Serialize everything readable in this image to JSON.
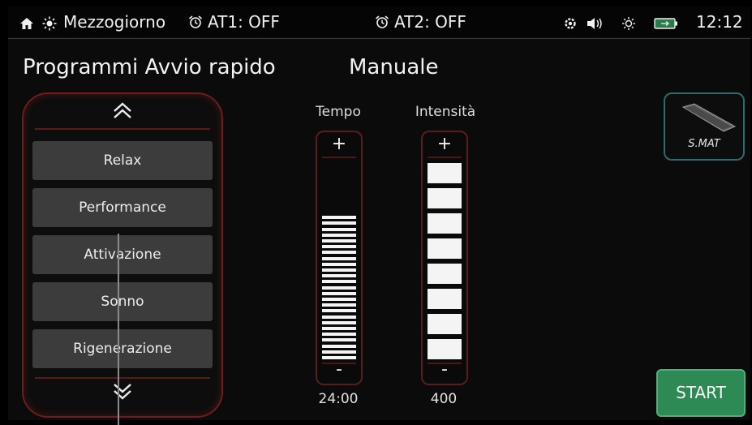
{
  "status_bar": {
    "home_icon": "home-icon",
    "weather_icon": "sun-icon",
    "location": "Mezzogiorno",
    "alarm1_icon": "alarm-clock-icon",
    "alarm1": "AT1: OFF",
    "alarm2_icon": "alarm-clock-icon",
    "alarm2": "AT2: OFF",
    "connection_icon": "gear-icon",
    "volume_icon": "speaker-icon",
    "brightness_icon": "brightness-icon",
    "battery_icon": "battery-icon",
    "time": "12:12"
  },
  "headings": {
    "programs": "Programmi Avvio rapido",
    "manual": "Manuale"
  },
  "programs": {
    "up_icon": "double-chevron-up-icon",
    "down_icon": "double-chevron-down-icon",
    "items": [
      {
        "label": "Relax"
      },
      {
        "label": "Performance"
      },
      {
        "label": "Attivazione"
      },
      {
        "label": "Sonno"
      },
      {
        "label": "Rigenerazione"
      }
    ]
  },
  "tempo": {
    "label": "Tempo",
    "plus": "+",
    "minus": "-",
    "value": "24:00",
    "fill_fraction": 0.76
  },
  "intensity": {
    "label": "Intensità",
    "plus": "+",
    "minus": "-",
    "value": "400",
    "level_segments": 8,
    "total_segments": 8
  },
  "device": {
    "label": "S.MAT"
  },
  "start": {
    "label": "START"
  },
  "colors": {
    "start_button": "#2d8a55",
    "panel_border": "#6e1c1c",
    "device_border": "#2f6b6e"
  }
}
